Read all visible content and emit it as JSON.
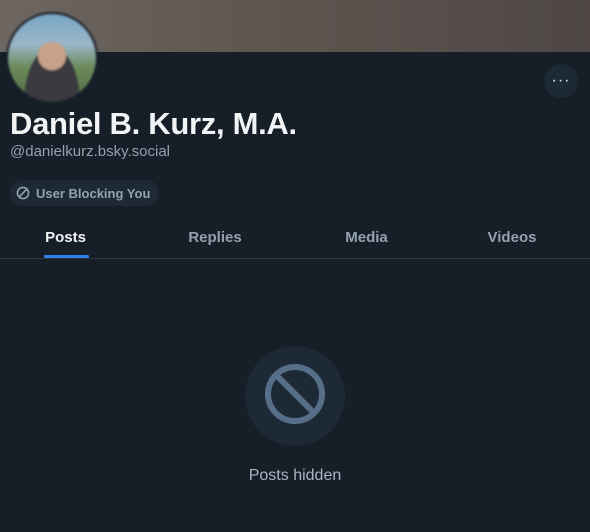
{
  "profile": {
    "display_name": "Daniel B. Kurz, M.A.",
    "handle": "@danielkurz.bsky.social",
    "avatar_icon": "user-avatar-photo",
    "more_icon": "ellipsis-icon",
    "more_label": "···"
  },
  "badge": {
    "label": "User Blocking You",
    "icon": "block-icon"
  },
  "tabs": [
    {
      "label": "Posts",
      "active": true
    },
    {
      "label": "Replies",
      "active": false
    },
    {
      "label": "Media",
      "active": false
    },
    {
      "label": "Videos",
      "active": false
    }
  ],
  "empty_state": {
    "icon": "block-icon",
    "message": "Posts hidden"
  },
  "colors": {
    "background": "#161e27",
    "accent": "#2f83ec",
    "muted_text": "#93a1b0",
    "surface": "#1e2936",
    "icon": "#566e88"
  }
}
